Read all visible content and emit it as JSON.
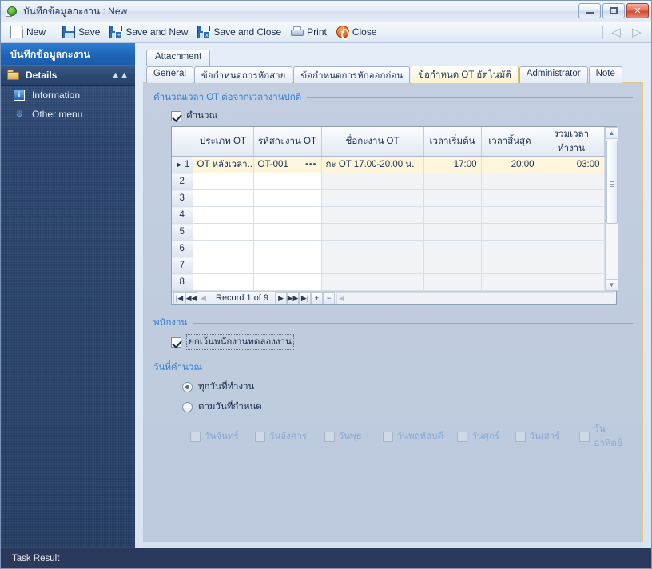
{
  "window": {
    "title": "บันทึกข้อมูลกะงาน : New",
    "app_icon": "globe-page-icon",
    "minimize_label": "Minimize",
    "maximize_label": "Maximize",
    "close_label": "✕"
  },
  "toolbar": {
    "items": [
      {
        "label": "New",
        "icon": "new-document-icon"
      },
      {
        "label": "Save",
        "icon": "save-disk-icon"
      },
      {
        "label": "Save and New",
        "icon": "save-and-new-icon"
      },
      {
        "label": "Save and Close",
        "icon": "save-and-close-icon"
      },
      {
        "label": "Print",
        "icon": "printer-icon"
      },
      {
        "label": "Close",
        "icon": "close-power-icon"
      }
    ],
    "nav_back": "◁",
    "nav_forward": "▷"
  },
  "sidebar": {
    "title": "บันทึกข้อมูลกะงาน",
    "details_header": "Details",
    "collapse_glyph": "⌃",
    "items": [
      {
        "label": "Information",
        "icon": "information-icon"
      },
      {
        "label": "Other menu",
        "icon": "double-chevron-down-icon"
      }
    ]
  },
  "tabs_top": [
    {
      "label": "Attachment"
    }
  ],
  "tabs_main": [
    {
      "label": "General",
      "active": false
    },
    {
      "label": "ข้อกำหนดการหักสาย",
      "active": false
    },
    {
      "label": "ข้อกำหนดการหักออกก่อน",
      "active": false
    },
    {
      "label": "ข้อกำหนด OT อัตโนมัติ",
      "active": true
    },
    {
      "label": "Administrator",
      "active": false
    },
    {
      "label": "Note",
      "active": false
    }
  ],
  "groups": {
    "ot_calc": {
      "title": "คำนวณเวลา OT ต่อจากเวลางานปกติ",
      "checkbox_label": "คำนวณ",
      "checkbox_checked": true
    },
    "employee": {
      "title": "พนักงาน",
      "checkbox_label": "ยกเว้นพนักงานทดลองงาน",
      "checkbox_checked": true
    },
    "calc_days": {
      "title": "วันที่คำนวณ",
      "radio_all_workdays": "ทุกวันที่ทำงาน",
      "radio_specified_days": "ตามวันที่กำหนด",
      "selected": "all_workdays",
      "days": [
        {
          "label": "วันจันทร์",
          "checked": false,
          "disabled": true
        },
        {
          "label": "วันอังคาร",
          "checked": false,
          "disabled": true
        },
        {
          "label": "วันพุธ",
          "checked": false,
          "disabled": true
        },
        {
          "label": "วันพฤหัสบดี",
          "checked": false,
          "disabled": true
        },
        {
          "label": "วันศุกร์",
          "checked": false,
          "disabled": true
        },
        {
          "label": "วันเสาร์",
          "checked": false,
          "disabled": true
        },
        {
          "label": "วันอาทิตย์",
          "checked": false,
          "disabled": true
        }
      ]
    }
  },
  "grid": {
    "columns": [
      {
        "header": "",
        "key": "rownum"
      },
      {
        "header": "ประเภท OT",
        "key": "ot_type"
      },
      {
        "header": "รหัสกะงาน OT",
        "key": "ot_code"
      },
      {
        "header": "ชื่อกะงาน OT",
        "key": "ot_name"
      },
      {
        "header": "เวลาเริ่มต้น",
        "key": "start_time"
      },
      {
        "header": "เวลาสิ้นสุด",
        "key": "end_time"
      },
      {
        "header": "รวมเวลาทำงาน",
        "key": "total_time"
      }
    ],
    "rows": [
      {
        "rownum": "1",
        "selected": true,
        "ot_type": "OT หลังเวลา...",
        "ot_code": "OT-001",
        "ot_code_ellipsis": "•••",
        "ot_name": "กะ OT 17.00-20.00 น.",
        "start_time": "17:00",
        "end_time": "20:00",
        "total_time": "03:00"
      },
      {
        "rownum": "2",
        "selected": false,
        "ot_type": "",
        "ot_code": "",
        "ot_name": "",
        "start_time": "",
        "end_time": "",
        "total_time": ""
      },
      {
        "rownum": "3",
        "selected": false,
        "ot_type": "",
        "ot_code": "",
        "ot_name": "",
        "start_time": "",
        "end_time": "",
        "total_time": ""
      },
      {
        "rownum": "4",
        "selected": false,
        "ot_type": "",
        "ot_code": "",
        "ot_name": "",
        "start_time": "",
        "end_time": "",
        "total_time": ""
      },
      {
        "rownum": "5",
        "selected": false,
        "ot_type": "",
        "ot_code": "",
        "ot_name": "",
        "start_time": "",
        "end_time": "",
        "total_time": ""
      },
      {
        "rownum": "6",
        "selected": false,
        "ot_type": "",
        "ot_code": "",
        "ot_name": "",
        "start_time": "",
        "end_time": "",
        "total_time": ""
      },
      {
        "rownum": "7",
        "selected": false,
        "ot_type": "",
        "ot_code": "",
        "ot_name": "",
        "start_time": "",
        "end_time": "",
        "total_time": ""
      },
      {
        "rownum": "8",
        "selected": false,
        "ot_type": "",
        "ot_code": "",
        "ot_name": "",
        "start_time": "",
        "end_time": "",
        "total_time": ""
      }
    ],
    "navigator": {
      "first": "|◀",
      "prev_page": "◀◀",
      "prev": "◀",
      "record_text": "Record 1 of 9",
      "next": "▶",
      "next_page": "▶▶",
      "last": "▶|",
      "add": "+",
      "remove": "−"
    }
  },
  "statusbar": {
    "text": "Task Result"
  },
  "colors": {
    "accent_blue": "#2f7fd4",
    "titlebar_blue": "#1f66b8",
    "sidebar_navy": "#27406a",
    "tab_active_cream": "#fdf2cd",
    "tab_border_amber": "#e0c880",
    "row_selected": "#fdf6dd",
    "statusbar_navy": "#2b3a5c",
    "panel_blue_gray": "#c3cfe0"
  }
}
